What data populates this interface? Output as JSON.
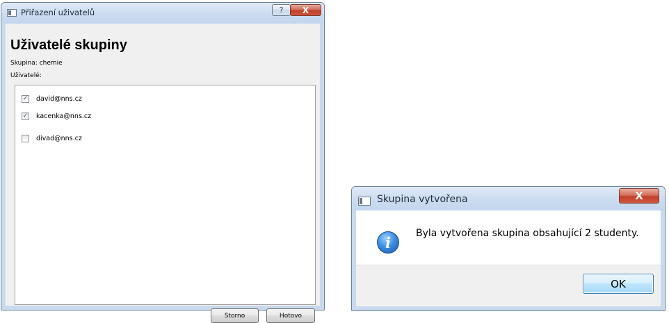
{
  "assign_dialog": {
    "title": "Přiřazení uživatelů",
    "help_glyph": "?",
    "close_glyph": "X",
    "heading": "Uživatelé skupiny",
    "group_label": "Skupina:",
    "group_value": "chemie",
    "users_label": "Uživatelé:",
    "users": [
      {
        "email": "david@nns.cz",
        "checked": true
      },
      {
        "email": "kacenka@nns.cz",
        "checked": true
      },
      {
        "email": "divad@nns.cz",
        "checked": false
      }
    ],
    "cancel_label": "Storno",
    "done_label": "Hotovo"
  },
  "message_box": {
    "title": "Skupina vytvořena",
    "close_glyph": "X",
    "info_glyph": "i",
    "message": "Byla vytvořena skupina obsahující 2 studenty.",
    "ok_label": "OK"
  }
}
